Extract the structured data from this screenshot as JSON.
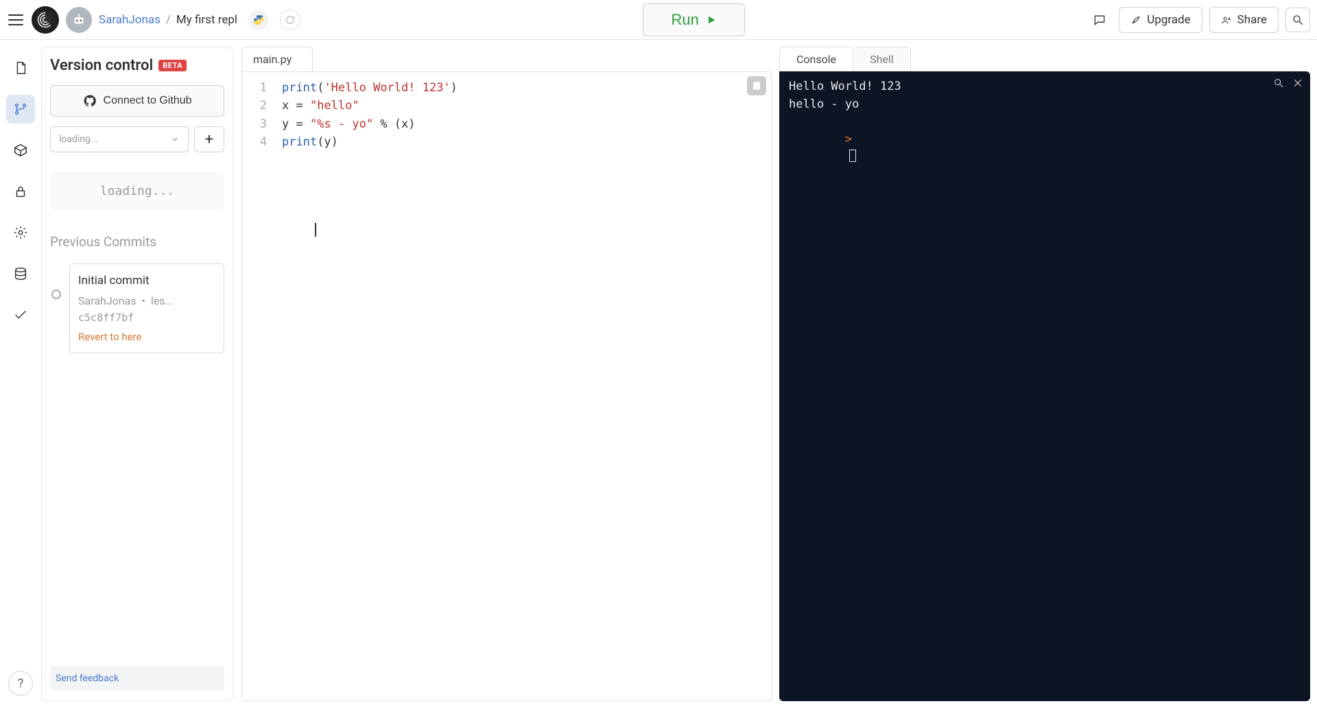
{
  "header": {
    "user": "SarahJonas",
    "slash": "/",
    "repl_name": "My first repl",
    "run_label": "Run",
    "upgrade_label": "Upgrade",
    "share_label": "Share"
  },
  "vc_panel": {
    "title": "Version control",
    "beta": "BETA",
    "connect_github": "Connect to Github",
    "branch_placeholder": "loading...",
    "loading_text": "loading...",
    "previous_commits_title": "Previous Commits",
    "commit": {
      "title": "Initial commit",
      "author": "SarahJonas",
      "sep": "•",
      "time_truncated": "les...",
      "hash": "c5c8ff7bf",
      "revert_label": "Revert to here"
    },
    "feedback": "Send feedback",
    "help_symbol": "?"
  },
  "editor": {
    "tab": "main.py",
    "lines": [
      {
        "n": "1",
        "parts": [
          {
            "t": "print",
            "c": "fn"
          },
          {
            "t": "(",
            "c": "punct"
          },
          {
            "t": "'Hello World! 123'",
            "c": "str"
          },
          {
            "t": ")",
            "c": "punct"
          }
        ]
      },
      {
        "n": "2",
        "parts": [
          {
            "t": "x ",
            "c": "punct"
          },
          {
            "t": "= ",
            "c": "punct"
          },
          {
            "t": "\"hello\"",
            "c": "str"
          }
        ]
      },
      {
        "n": "3",
        "parts": [
          {
            "t": "y ",
            "c": "punct"
          },
          {
            "t": "= ",
            "c": "punct"
          },
          {
            "t": "\"%s - yo\"",
            "c": "str"
          },
          {
            "t": " % (x)",
            "c": "punct"
          }
        ]
      },
      {
        "n": "4",
        "parts": [
          {
            "t": "print",
            "c": "fn"
          },
          {
            "t": "(y)",
            "c": "punct"
          }
        ]
      }
    ]
  },
  "console": {
    "tabs": {
      "console": "Console",
      "shell": "Shell"
    },
    "output_lines": [
      "Hello World! 123",
      "hello - yo"
    ],
    "prompt": ">"
  }
}
